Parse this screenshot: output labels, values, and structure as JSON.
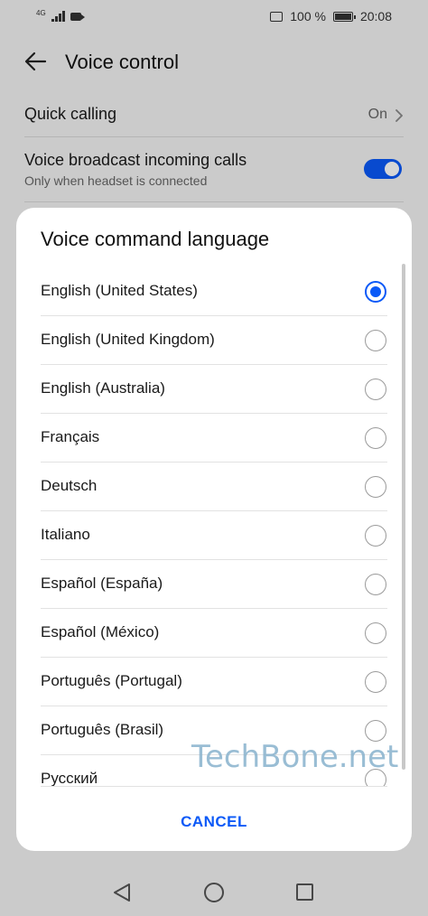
{
  "status_bar": {
    "network": "4G",
    "battery_percent": "100 %",
    "time": "20:08"
  },
  "header": {
    "title": "Voice control",
    "back_icon": "arrow-left-icon"
  },
  "settings": {
    "quick_calling": {
      "label": "Quick calling",
      "value": "On"
    },
    "voice_broadcast": {
      "label": "Voice broadcast incoming calls",
      "sublabel": "Only when headset is connected",
      "toggle_on": true
    }
  },
  "dialog": {
    "title": "Voice command language",
    "options": [
      {
        "label": "English (United States)",
        "selected": true
      },
      {
        "label": "English (United Kingdom)",
        "selected": false
      },
      {
        "label": "English (Australia)",
        "selected": false
      },
      {
        "label": "Français",
        "selected": false
      },
      {
        "label": "Deutsch",
        "selected": false
      },
      {
        "label": "Italiano",
        "selected": false
      },
      {
        "label": "Español (España)",
        "selected": false
      },
      {
        "label": "Español (México)",
        "selected": false
      },
      {
        "label": "Português (Portugal)",
        "selected": false
      },
      {
        "label": "Português (Brasil)",
        "selected": false
      },
      {
        "label": "Русский",
        "selected": false
      }
    ],
    "cancel_label": "CANCEL"
  },
  "watermark": "TechBone.net",
  "colors": {
    "accent": "#0a59f7",
    "background": "#f2f2f2",
    "dialog": "#ffffff"
  }
}
